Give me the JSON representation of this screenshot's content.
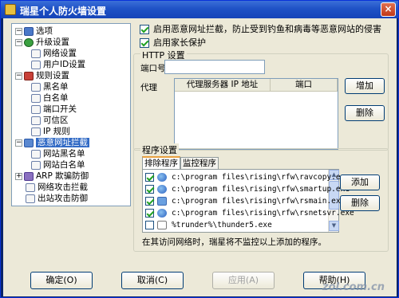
{
  "window": {
    "title": "瑞星个人防火墙设置",
    "close_label": "×"
  },
  "tree": {
    "items": [
      {
        "label": "选项",
        "icon": "options-icon"
      },
      {
        "label": "升级设置",
        "icon": "update-icon"
      },
      {
        "label": "网络设置",
        "icon": "page-icon"
      },
      {
        "label": "用户ID设置",
        "icon": "page-icon"
      },
      {
        "label": "规则设置",
        "icon": "rules-icon"
      },
      {
        "label": "黑名单",
        "icon": "page-icon"
      },
      {
        "label": "白名单",
        "icon": "page-icon"
      },
      {
        "label": "端口开关",
        "icon": "page-icon"
      },
      {
        "label": "可信区",
        "icon": "page-icon"
      },
      {
        "label": "IP 规则",
        "icon": "page-icon"
      },
      {
        "label": "恶意网址拦截",
        "icon": "shield-icon"
      },
      {
        "label": "网站黑名单",
        "icon": "page-icon"
      },
      {
        "label": "网站白名单",
        "icon": "page-icon"
      },
      {
        "label": "ARP 欺骗防御",
        "icon": "arp-icon"
      },
      {
        "label": "网络攻击拦截",
        "icon": "page-icon"
      },
      {
        "label": "出站攻击防御",
        "icon": "page-icon"
      }
    ],
    "selected": "恶意网址拦截"
  },
  "options": {
    "enable_malicious_url": "启用恶意网址拦截，防止受到钓鱼和病毒等恶意网站的侵害",
    "enable_parental": "启用家长保护"
  },
  "http": {
    "group_title": "HTTP 设置",
    "port_label": "端口号",
    "port_value": "",
    "proxy_label": "代理",
    "columns": [
      "代理服务器 IP 地址",
      "端口"
    ],
    "add_label": "增加",
    "delete_label": "删除"
  },
  "program": {
    "group_title": "程序设置",
    "tabs": [
      "排除程序",
      "监控程序"
    ],
    "active_tab": "排除程序",
    "items": [
      {
        "path": "c:\\program files\\rising\\rfw\\ravcopy.exe",
        "checked": true,
        "icon": "app-icon"
      },
      {
        "path": "c:\\program files\\rising\\rfw\\smartup.exe",
        "checked": true,
        "icon": "app-icon"
      },
      {
        "path": "c:\\program files\\rising\\rfw\\rsmain.exe",
        "checked": true,
        "icon": "window-icon"
      },
      {
        "path": "c:\\program files\\rising\\rfw\\rsnetsvr.exe",
        "checked": true,
        "icon": "app-icon"
      },
      {
        "path": "%trunder%\\thunder5.exe",
        "checked": false,
        "icon": "blank-icon"
      }
    ],
    "add_label": "添加",
    "delete_label": "删除",
    "note": "在其访问网络时，瑞星将不监控以上添加的程序。"
  },
  "footer": {
    "ok": "确定(O)",
    "cancel": "取消(C)",
    "apply": "应用(A)",
    "help": "帮助(H)"
  },
  "watermark": "zol.com.cn"
}
